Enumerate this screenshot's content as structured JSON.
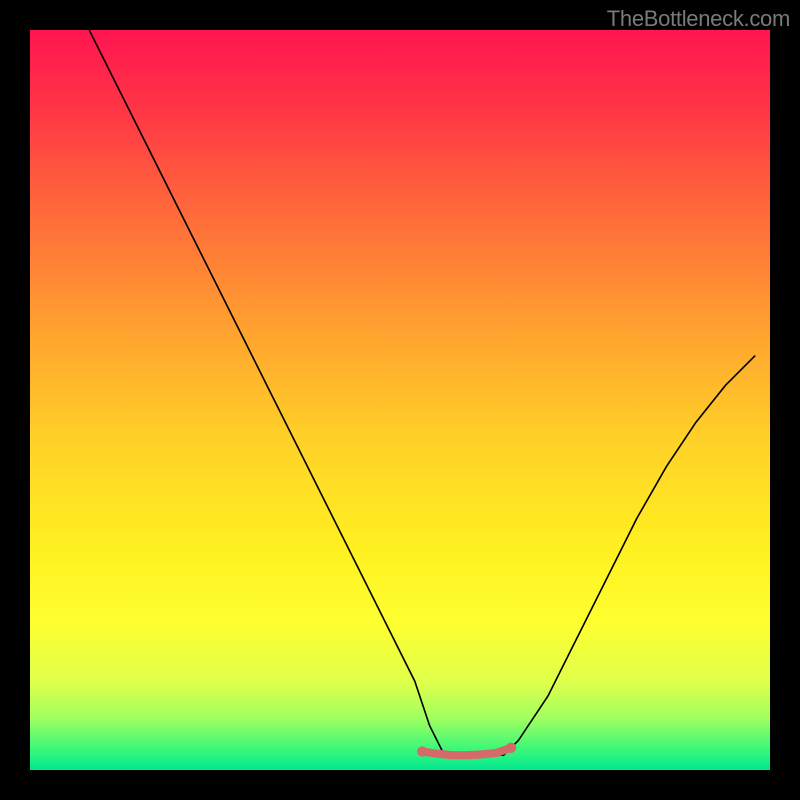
{
  "watermark": "TheBottleneck.com",
  "chart_data": {
    "type": "line",
    "title": "",
    "xlabel": "",
    "ylabel": "",
    "xlim": [
      0,
      100
    ],
    "ylim": [
      0,
      100
    ],
    "background_gradient": {
      "top_color": "#ff1550",
      "mid_color": "#fff020",
      "bottom_color": "#00e890",
      "meaning": "bottleneck severity — red high, green low"
    },
    "series": [
      {
        "name": "bottleneck-curve",
        "color": "#000000",
        "x": [
          8,
          12,
          16,
          20,
          24,
          28,
          32,
          36,
          40,
          44,
          48,
          52,
          54,
          56,
          60,
          64,
          66,
          70,
          74,
          78,
          82,
          86,
          90,
          94,
          98
        ],
        "y": [
          100,
          92,
          84,
          76,
          68,
          60,
          52,
          44,
          36,
          28,
          20,
          12,
          6,
          2,
          2,
          2,
          4,
          10,
          18,
          26,
          34,
          41,
          47,
          52,
          56
        ]
      },
      {
        "name": "optimal-flat-segment",
        "color": "#d66a6a",
        "stroke_width": 8,
        "x": [
          53,
          55,
          57,
          59,
          61,
          63,
          65
        ],
        "y": [
          2.5,
          2.2,
          2.0,
          2.0,
          2.1,
          2.3,
          3.0
        ]
      }
    ],
    "annotations": []
  }
}
